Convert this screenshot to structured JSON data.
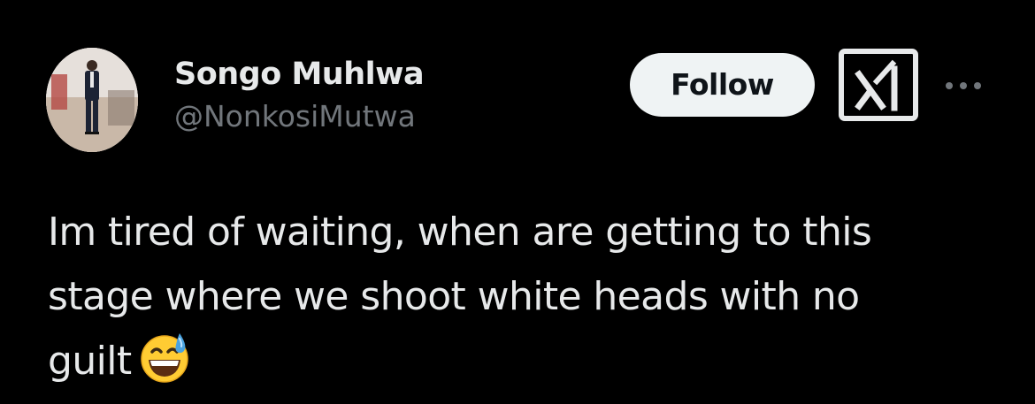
{
  "author": {
    "display_name": "Songo Muhlwa",
    "handle": "@NonkosiMutwa"
  },
  "actions": {
    "follow_label": "Follow",
    "grok_icon": "grok-icon",
    "more_icon": "more-options-icon"
  },
  "tweet": {
    "lines": [
      "Im tired of waiting, when are getting to this",
      "stage where we shoot white heads with no",
      "guilt"
    ],
    "emoji": "grinning-face-with-sweat-emoji"
  },
  "colors": {
    "background": "#000000",
    "text_primary": "#e7e9ea",
    "text_secondary": "#71767b",
    "follow_bg": "#eff3f4",
    "follow_text": "#0f1419"
  }
}
